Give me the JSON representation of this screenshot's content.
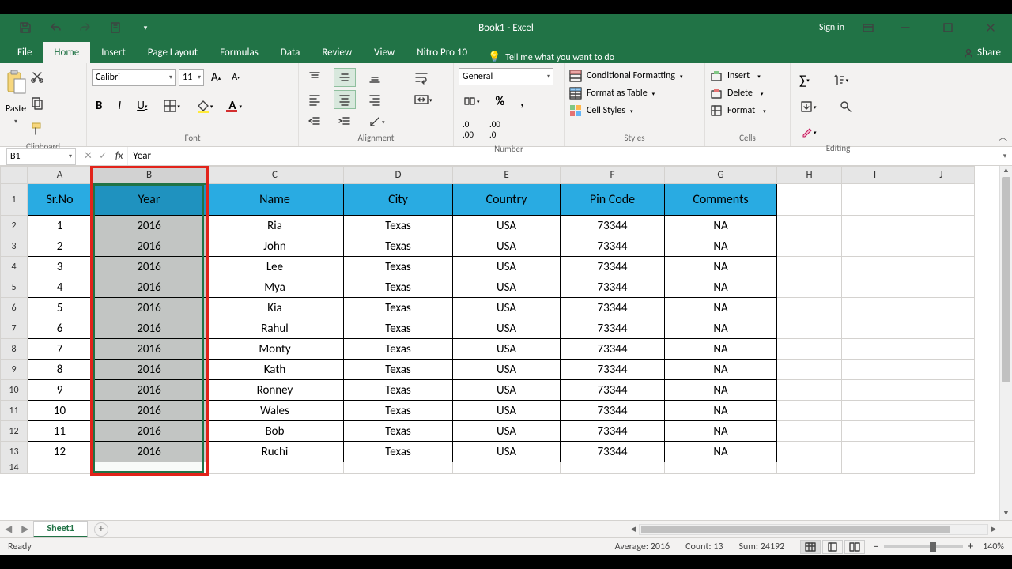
{
  "title": "Book1  -  Excel",
  "signin": "Sign in",
  "menutabs": [
    "File",
    "Home",
    "Insert",
    "Page Layout",
    "Formulas",
    "Data",
    "Review",
    "View",
    "Nitro Pro 10"
  ],
  "active_tab": "Home",
  "tellme": "Tell me what you want to do",
  "share": "Share",
  "ribbon": {
    "clipboard": {
      "label": "Clipboard",
      "paste": "Paste"
    },
    "font": {
      "label": "Font",
      "name": "Calibri",
      "size": "11"
    },
    "alignment": {
      "label": "Alignment"
    },
    "number": {
      "label": "Number",
      "format": "General"
    },
    "styles": {
      "label": "Styles",
      "conditional": "Conditional Formatting",
      "table": "Format as Table",
      "cell": "Cell Styles"
    },
    "cells": {
      "label": "Cells",
      "insert": "Insert",
      "delete": "Delete",
      "format": "Format"
    },
    "editing": {
      "label": "Editing"
    }
  },
  "namebox": "B1",
  "formula": "Year",
  "columns": [
    "A",
    "B",
    "C",
    "D",
    "E",
    "F",
    "G",
    "H",
    "I",
    "J"
  ],
  "row_count_visible": 14,
  "headers": [
    "Sr.No",
    "Year",
    "Name",
    "City",
    "Country",
    "Pin Code",
    "Comments"
  ],
  "rows": [
    [
      "1",
      "2016",
      "Ria",
      "Texas",
      "USA",
      "73344",
      "NA"
    ],
    [
      "2",
      "2016",
      "John",
      "Texas",
      "USA",
      "73344",
      "NA"
    ],
    [
      "3",
      "2016",
      "Lee",
      "Texas",
      "USA",
      "73344",
      "NA"
    ],
    [
      "4",
      "2016",
      "Mya",
      "Texas",
      "USA",
      "73344",
      "NA"
    ],
    [
      "5",
      "2016",
      "Kia",
      "Texas",
      "USA",
      "73344",
      "NA"
    ],
    [
      "6",
      "2016",
      "Rahul",
      "Texas",
      "USA",
      "73344",
      "NA"
    ],
    [
      "7",
      "2016",
      "Monty",
      "Texas",
      "USA",
      "73344",
      "NA"
    ],
    [
      "8",
      "2016",
      "Kath",
      "Texas",
      "USA",
      "73344",
      "NA"
    ],
    [
      "9",
      "2016",
      "Ronney",
      "Texas",
      "USA",
      "73344",
      "NA"
    ],
    [
      "10",
      "2016",
      "Wales",
      "Texas",
      "USA",
      "73344",
      "NA"
    ],
    [
      "11",
      "2016",
      "Bob",
      "Texas",
      "USA",
      "73344",
      "NA"
    ],
    [
      "12",
      "2016",
      "Ruchi",
      "Texas",
      "USA",
      "73344",
      "NA"
    ]
  ],
  "sheet_name": "Sheet1",
  "status": {
    "ready": "Ready",
    "average": "Average: 2016",
    "count": "Count: 13",
    "sum": "Sum: 24192",
    "zoom": "140%"
  },
  "selected_column_index": 1
}
